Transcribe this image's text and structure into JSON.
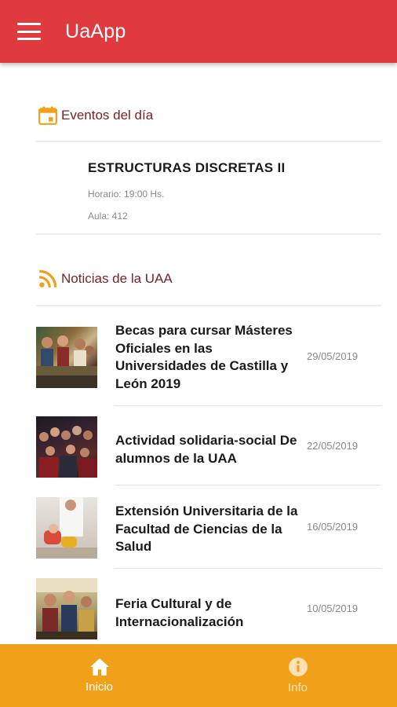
{
  "app": {
    "title": "UaApp"
  },
  "colors": {
    "primary": "#e03a3e",
    "accent": "#f0a119",
    "section_label": "#7a1f24"
  },
  "events": {
    "heading": "Eventos del día",
    "icon": "calendar-icon",
    "item": {
      "title": "ESTRUCTURAS DISCRETAS II",
      "schedule": "Horario: 19:00 Hs.",
      "room": "Aula: 412"
    }
  },
  "news": {
    "heading": "Noticias de la UAA",
    "icon": "rss-icon",
    "items": [
      {
        "title": "Becas para cursar Másteres Oficiales en las Universidades de Castilla y León 2019",
        "date": "29/05/2019"
      },
      {
        "title": "Actividad solidaria-social De alumnos de la UAA",
        "date": "22/05/2019"
      },
      {
        "title": "Extensión Universitaria de la Facultad de Ciencias de la Salud",
        "date": "16/05/2019"
      },
      {
        "title": "Feria Cultural y de Internacionalización",
        "date": "10/05/2019"
      }
    ]
  },
  "bottom_nav": {
    "tabs": [
      {
        "label": "Inicio",
        "icon": "home-icon",
        "active": true
      },
      {
        "label": "Info",
        "icon": "info-icon",
        "active": false
      }
    ]
  }
}
